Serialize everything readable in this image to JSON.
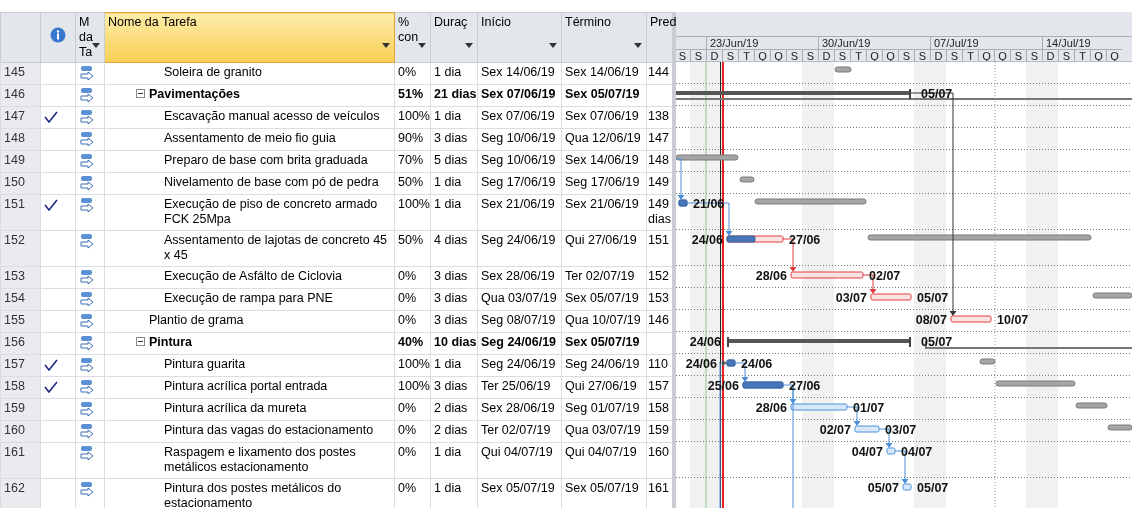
{
  "columns": [
    {
      "kind": "id"
    },
    {
      "kind": "info"
    },
    {
      "kind": "text",
      "label": "M da Ta",
      "filter": true,
      "selected": false
    },
    {
      "kind": "text",
      "label": "Nome da Tarefa",
      "filter": true,
      "selected": true
    },
    {
      "kind": "text",
      "label": "% con",
      "filter": true,
      "selected": false
    },
    {
      "kind": "text",
      "label": "Duraç",
      "filter": true,
      "selected": false
    },
    {
      "kind": "text",
      "label": "Início",
      "filter": true,
      "selected": false
    },
    {
      "kind": "text",
      "label": "Término",
      "filter": true,
      "selected": false
    },
    {
      "kind": "text",
      "label": "Pred",
      "filter": false,
      "selected": false
    }
  ],
  "timescale": {
    "weeks": [
      "23/Jun/19",
      "30/Jun/19",
      "07/Jul/19",
      "14/Jul/19"
    ],
    "days": [
      {
        "label": "S",
        "weekend": false
      },
      {
        "label": "S",
        "weekend": true
      },
      {
        "label": "D",
        "weekend": true
      },
      {
        "label": "S",
        "weekend": false
      },
      {
        "label": "T",
        "weekend": false
      },
      {
        "label": "Q",
        "weekend": false
      },
      {
        "label": "Q",
        "weekend": false
      },
      {
        "label": "S",
        "weekend": false
      },
      {
        "label": "S",
        "weekend": true
      },
      {
        "label": "D",
        "weekend": true
      },
      {
        "label": "S",
        "weekend": false
      },
      {
        "label": "T",
        "weekend": false
      },
      {
        "label": "Q",
        "weekend": false
      },
      {
        "label": "Q",
        "weekend": false
      },
      {
        "label": "S",
        "weekend": false
      },
      {
        "label": "S",
        "weekend": true
      },
      {
        "label": "D",
        "weekend": true
      },
      {
        "label": "S",
        "weekend": false
      },
      {
        "label": "T",
        "weekend": false
      },
      {
        "label": "Q",
        "weekend": false
      },
      {
        "label": "Q",
        "weekend": false
      },
      {
        "label": "S",
        "weekend": false
      },
      {
        "label": "S",
        "weekend": true
      },
      {
        "label": "D",
        "weekend": true
      },
      {
        "label": "S",
        "weekend": false
      },
      {
        "label": "T",
        "weekend": false
      },
      {
        "label": "Q",
        "weekend": false
      },
      {
        "label": "Q",
        "weekend": false
      }
    ]
  },
  "rows": [
    {
      "children": [
        {
          "id": "145",
          "completed": false,
          "name": "Soleira de granito",
          "pct": "0%",
          "duration": "1 dia",
          "start": "Sex 14/06/19",
          "finish": "Sex 14/06/19",
          "pred": "144"
        }
      ]
    },
    {
      "id": "146",
      "completed": false,
      "expanded": true,
      "name": "Pavimentações",
      "pct": "51%",
      "duration": "21 dias",
      "start": "Sex 07/06/19",
      "finish": "Sex 05/07/19",
      "bar": {
        "end_label": "05/07"
      },
      "children": [
        {
          "id": "147",
          "completed": true,
          "name": "Escavação manual acesso de veículos",
          "pct": "100%",
          "duration": "1 dia",
          "start": "Sex 07/06/19",
          "finish": "Sex 07/06/19",
          "pred": "138"
        },
        {
          "id": "148",
          "completed": false,
          "name": "Assentamento de meio fio guia",
          "pct": "90%",
          "duration": "3 dias",
          "start": "Seg 10/06/19",
          "finish": "Qua 12/06/19",
          "pred": "147"
        },
        {
          "id": "149",
          "completed": false,
          "name": "Preparo de base com brita graduada",
          "pct": "70%",
          "duration": "5 dias",
          "start": "Seg 10/06/19",
          "finish": "Sex 14/06/19",
          "pred": "148"
        },
        {
          "id": "150",
          "completed": false,
          "name": "Nivelamento de base com pó de pedra",
          "pct": "50%",
          "duration": "1 dia",
          "start": "Seg 17/06/19",
          "finish": "Seg 17/06/19",
          "pred": "149"
        },
        {
          "id": "151",
          "completed": true,
          "name": "Execução de piso de concreto armado FCK 25Mpa",
          "pct": "100%",
          "duration": "1 dia",
          "start": "Sex 21/06/19",
          "finish": "Sex 21/06/19",
          "pred": "149 dias",
          "bar": {
            "critical": false,
            "end_label": "21/06",
            "linked": true
          }
        },
        {
          "id": "152",
          "completed": false,
          "name": "Assentamento de lajotas de concreto 45 x 45",
          "pct": "50%",
          "duration": "4 dias",
          "start": "Seg 24/06/19",
          "finish": "Qui 27/06/19",
          "pred": "151",
          "bar": {
            "critical": true,
            "start_label": "24/06",
            "end_label": "27/06",
            "linked": true
          }
        },
        {
          "id": "153",
          "completed": false,
          "name": "Execução de Asfálto de Ciclovia",
          "pct": "0%",
          "duration": "3 dias",
          "start": "Sex 28/06/19",
          "finish": "Ter 02/07/19",
          "pred": "152",
          "bar": {
            "critical": true,
            "start_label": "28/06",
            "end_label": "02/07",
            "linked": true
          }
        },
        {
          "id": "154",
          "completed": false,
          "name": "Execução de rampa para PNE",
          "pct": "0%",
          "duration": "3 dias",
          "start": "Qua 03/07/19",
          "finish": "Sex 05/07/19",
          "pred": "153",
          "bar": {
            "critical": true,
            "start_label": "03/07",
            "end_label": "05/07",
            "linked": true
          }
        }
      ]
    },
    {
      "id": "155",
      "completed": false,
      "name": "Plantio de grama",
      "pct": "0%",
      "duration": "3 dias",
      "start": "Seg 08/07/19",
      "finish": "Qua 10/07/19",
      "pred": "146",
      "bar": {
        "critical": true,
        "start_label": "08/07",
        "end_label": "10/07",
        "linked": true
      }
    },
    {
      "id": "156",
      "completed": false,
      "expanded": true,
      "name": "Pintura",
      "pct": "40%",
      "duration": "10 dias",
      "start": "Seg 24/06/19",
      "finish": "Sex 05/07/19",
      "bar": {
        "start_label": "24/06",
        "end_label": "05/07"
      },
      "children": [
        {
          "id": "157",
          "completed": true,
          "name": "Pintura guarita",
          "pct": "100%",
          "duration": "1 dia",
          "start": "Seg 24/06/19",
          "finish": "Seg 24/06/19",
          "pred": "110",
          "bar": {
            "critical": false,
            "start_label": "24/06",
            "end_label": "24/06",
            "linked": true
          }
        },
        {
          "id": "158",
          "completed": true,
          "name": "Pintura acrílica portal entrada",
          "pct": "100%",
          "duration": "3 dias",
          "start": "Ter 25/06/19",
          "finish": "Qui 27/06/19",
          "pred": "157",
          "bar": {
            "critical": false,
            "start_label": "25/06",
            "end_label": "27/06",
            "linked": true
          }
        },
        {
          "id": "159",
          "completed": false,
          "name": "Pintura acrílica da mureta",
          "pct": "0%",
          "duration": "2 dias",
          "start": "Sex 28/06/19",
          "finish": "Seg 01/07/19",
          "pred": "158",
          "bar": {
            "critical": false,
            "start_label": "28/06",
            "end_label": "01/07",
            "linked": true
          }
        },
        {
          "id": "160",
          "completed": false,
          "name": "Pintura das vagas do estacionamento",
          "pct": "0%",
          "duration": "2 dias",
          "start": "Ter 02/07/19",
          "finish": "Qua 03/07/19",
          "pred": "159",
          "bar": {
            "critical": false,
            "start_label": "02/07",
            "end_label": "03/07",
            "linked": true
          }
        },
        {
          "id": "161",
          "completed": false,
          "name": "Raspagem e lixamento dos postes metálicos estacionamento",
          "pct": "0%",
          "duration": "1 dia",
          "start": "Qui 04/07/19",
          "finish": "Qui 04/07/19",
          "pred": "160",
          "bar": {
            "critical": false,
            "start_label": "04/07",
            "end_label": "04/07",
            "linked": true
          }
        },
        {
          "id": "162",
          "completed": false,
          "name": "Pintura dos postes metálicos do estacionamento",
          "pct": "0%",
          "duration": "1 dia",
          "start": "Sex 05/07/19",
          "finish": "Sex 05/07/19",
          "pred": "161",
          "bar": {
            "critical": false,
            "start_label": "05/07",
            "end_label": "05/07",
            "linked": true
          }
        }
      ]
    }
  ]
}
